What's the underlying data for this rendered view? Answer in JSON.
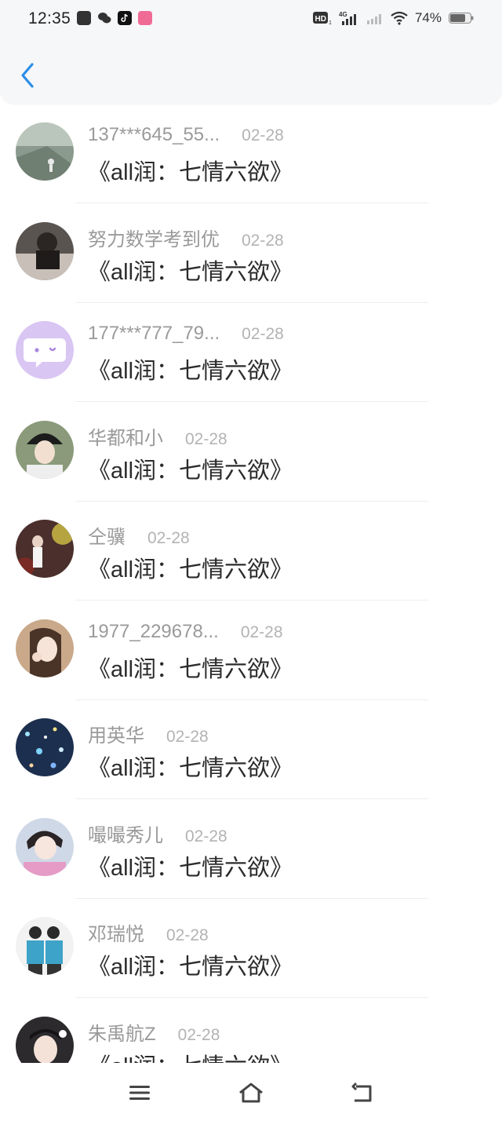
{
  "status_bar": {
    "time": "12:35",
    "battery_text": "74%",
    "battery_level": 0.74,
    "network": "4G",
    "app_icons": [
      "scan-app-icon",
      "wechat-icon",
      "tiktok-icon",
      "pink-app-icon"
    ]
  },
  "header": {
    "back_icon": "chevron-left-icon",
    "accent_color": "#2a8ee6"
  },
  "comments": [
    {
      "name": "137***645_55...",
      "date": "02-28",
      "text": "《all润：七情六欲》",
      "avatar_color": "#8a9a8c"
    },
    {
      "name": "努力数学考到优",
      "date": "02-28",
      "text": "《all润：七情六欲》",
      "avatar_color": "#5a5450"
    },
    {
      "name": "177***777_79...",
      "date": "02-28",
      "text": "《all润：七情六欲》",
      "avatar_color": "#d9c6f3"
    },
    {
      "name": "华都和小",
      "date": "02-28",
      "text": "《all润：七情六欲》",
      "avatar_color": "#3c3a36"
    },
    {
      "name": "仝骥",
      "date": "02-28",
      "text": "《all润：七情六欲》",
      "avatar_color": "#4a2f2c"
    },
    {
      "name": "1977_229678...",
      "date": "02-28",
      "text": "《all润：七情六欲》",
      "avatar_color": "#c9a98a"
    },
    {
      "name": "用英华",
      "date": "02-28",
      "text": "《all润：七情六欲》",
      "avatar_color": "#1d2f4e"
    },
    {
      "name": "嘬嘬秀儿",
      "date": "02-28",
      "text": "《all润：七情六欲》",
      "avatar_color": "#b7a0b8"
    },
    {
      "name": "邓瑞悦",
      "date": "02-28",
      "text": "《all润：七情六欲》",
      "avatar_color": "#3da3c8"
    },
    {
      "name": "朱禹航Z",
      "date": "02-28",
      "text": "《all润：七情六欲》",
      "avatar_color": "#2c2a2c"
    }
  ],
  "nav_bar": {
    "menu_icon": "menu-icon",
    "home_icon": "home-icon",
    "back_icon": "return-icon"
  }
}
